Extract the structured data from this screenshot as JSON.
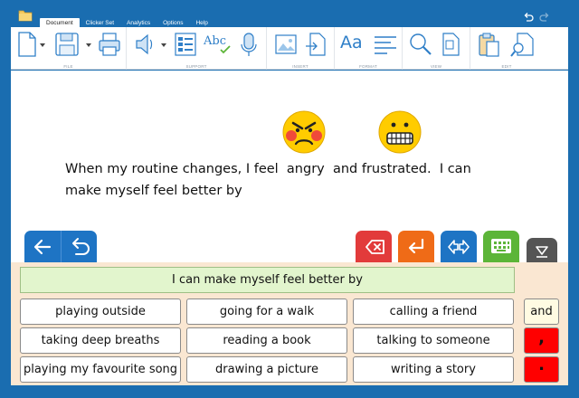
{
  "menu": {
    "tabs": [
      {
        "label": "Document",
        "active": true
      },
      {
        "label": "Clicker Set",
        "active": false
      },
      {
        "label": "Analytics",
        "active": false
      },
      {
        "label": "Options",
        "active": false
      },
      {
        "label": "Help",
        "active": false
      }
    ]
  },
  "ribbon": {
    "groups": {
      "file": "FILE",
      "support": "SUPPORT",
      "insert": "INSERT",
      "format": "FORMAT",
      "view": "VIEW",
      "edit": "EDIT"
    },
    "format_glyph": "Aa",
    "spell_glyph": "Abc"
  },
  "document": {
    "line1": "When my routine changes, I feel  angry  and frustrated.  I can",
    "line2": "make myself feel better by",
    "symbols": [
      "angry-face",
      "grimacing-face"
    ]
  },
  "grid": {
    "chat_bar": "I can make myself feel better by",
    "cells": [
      [
        "playing outside",
        "going for a walk",
        "calling a friend"
      ],
      [
        "taking deep breaths",
        "reading a book",
        "talking to someone"
      ],
      [
        "playing my favourite song",
        "drawing a picture",
        "writing a story"
      ]
    ],
    "side": [
      {
        "label": "and",
        "color": "#fffbe2"
      },
      {
        "label": ",",
        "color": "#ff0000"
      },
      {
        "label": ".",
        "color": "#ff0000"
      }
    ]
  },
  "colors": {
    "frame": "#1a6db0",
    "accent_blue": "#1e74c4",
    "delete": "#e23b3b",
    "enter": "#ef6b17",
    "keyboard": "#5cb538",
    "collapse": "#555555",
    "grid_bg": "#fae7d2",
    "chat_bar": "#e2f5cd"
  }
}
